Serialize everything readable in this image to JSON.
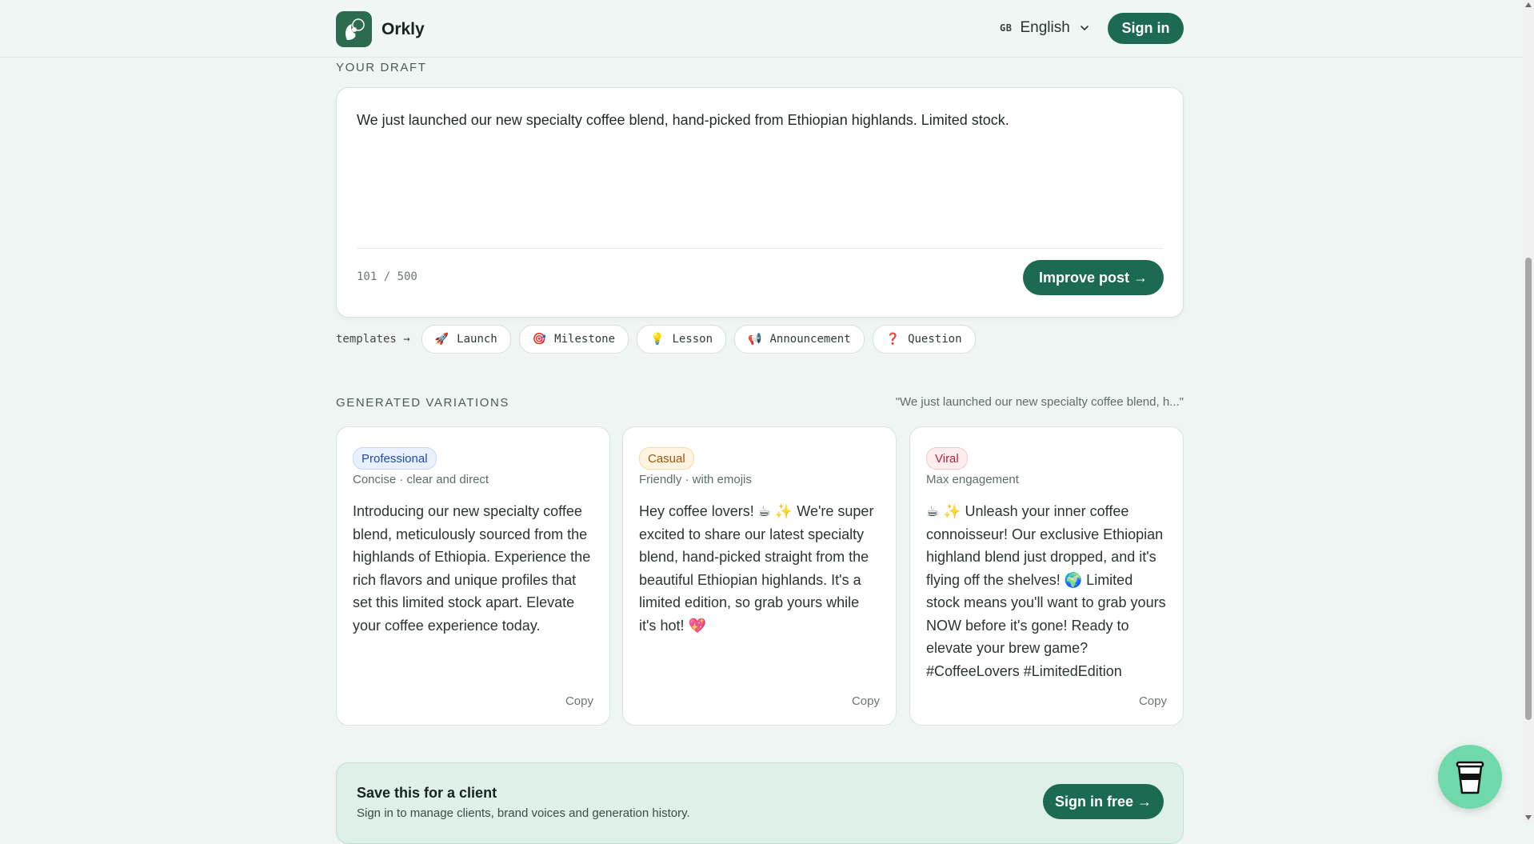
{
  "header": {
    "brand_name": "Orkly",
    "lang_flag": "GB",
    "language": "English",
    "signin_label": "Sign in"
  },
  "draft": {
    "section_label": "YOUR DRAFT",
    "text": "We just launched our new specialty coffee blend, hand-picked from Ethiopian highlands. Limited stock.",
    "counter": "101 / 500",
    "improve_label": "Improve post →"
  },
  "templates": {
    "label": "templates →",
    "items": [
      {
        "icon": "🚀",
        "label": "Launch",
        "icon_name": "rocket-icon"
      },
      {
        "icon": "🎯",
        "label": "Milestone",
        "icon_name": "target-icon"
      },
      {
        "icon": "💡",
        "label": "Lesson",
        "icon_name": "lightbulb-icon"
      },
      {
        "icon": "📢",
        "label": "Announcement",
        "icon_name": "megaphone-icon"
      },
      {
        "icon": "❓",
        "label": "Question",
        "icon_name": "question-icon"
      }
    ]
  },
  "variations": {
    "section_label": "GENERATED VARIATIONS",
    "echo": "\"We just launched our new specialty coffee blend, h...\"",
    "cards": [
      {
        "badge": "Professional",
        "subtitle": "Concise · clear and direct",
        "body": "Introducing our new specialty coffee blend, meticulously sourced from the highlands of Ethiopia. Experience the rich flavors and unique profiles that set this limited stock apart. Elevate your coffee experience today.",
        "copy_label": "Copy"
      },
      {
        "badge": "Casual",
        "subtitle": "Friendly · with emojis",
        "body": "Hey coffee lovers! ☕ ✨ We're super excited to share our latest specialty blend, hand-picked straight from the beautiful Ethiopian highlands. It's a limited edition, so grab yours while it's hot! 💖",
        "copy_label": "Copy"
      },
      {
        "badge": "Viral",
        "subtitle": "Max engagement",
        "body": "☕ ✨ Unleash your inner coffee connoisseur! Our exclusive Ethiopian highland blend just dropped, and it's flying off the shelves! 🌍 Limited stock means you'll want to grab yours NOW before it's gone! Ready to elevate your brew game? #CoffeeLovers #LimitedEdition",
        "copy_label": "Copy"
      }
    ]
  },
  "save_banner": {
    "title": "Save this for a client",
    "subtitle": "Sign in to manage clients, brand voices and generation history.",
    "button_label": "Sign in free →"
  },
  "colors": {
    "accent": "#1c6a52",
    "background": "#eef5f2",
    "fab": "#6fd9ab"
  }
}
